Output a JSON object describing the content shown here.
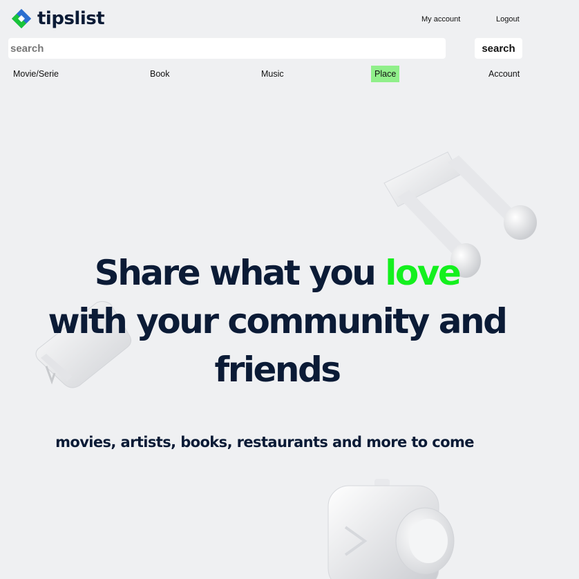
{
  "header": {
    "logo_text": "tipslist",
    "my_account": "My account",
    "logout": "Logout"
  },
  "search": {
    "placeholder": "search",
    "value": "",
    "button_label": "search"
  },
  "nav": {
    "items": [
      {
        "label": "Movie/Serie"
      },
      {
        "label": "Book"
      },
      {
        "label": "Music"
      },
      {
        "label": "Place",
        "active": true
      },
      {
        "label": "Account"
      }
    ]
  },
  "hero": {
    "line1_prefix": "Share what you ",
    "line1_accent": "love",
    "line2": "with your community and",
    "line3": "friends",
    "subtitle": "movies, artists, books, restaurants and more to come"
  },
  "colors": {
    "background": "#eff0f2",
    "text_dark": "#0b1b36",
    "accent_green": "#14f01e",
    "active_tab": "#90ef8a",
    "logo_blue": "#1f4fa8",
    "logo_green": "#19c43a"
  },
  "icons": [
    "logo-diamond-icon",
    "music-note-icon",
    "book-icon",
    "camera-icon"
  ]
}
